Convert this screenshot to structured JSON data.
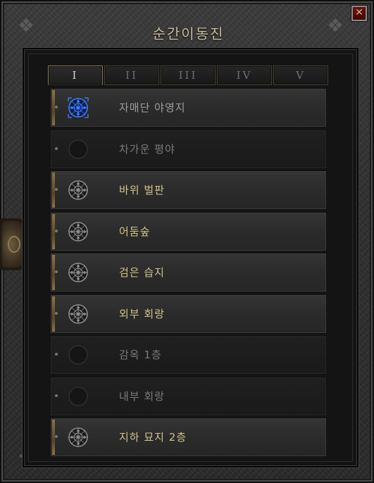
{
  "window": {
    "title": "순간이동진",
    "close_glyph": "✕"
  },
  "tabs": [
    {
      "label": "I",
      "active": true
    },
    {
      "label": "II",
      "active": false
    },
    {
      "label": "III",
      "active": false
    },
    {
      "label": "IV",
      "active": false
    },
    {
      "label": "V",
      "active": false
    }
  ],
  "waypoints": [
    {
      "label": "자매단 야영지",
      "state": "current",
      "icon": "waypoint-active-icon"
    },
    {
      "label": "차가운 평야",
      "state": "locked",
      "icon": "waypoint-empty-icon"
    },
    {
      "label": "바위 벌판",
      "state": "unlocked",
      "icon": "waypoint-icon"
    },
    {
      "label": "어둠숲",
      "state": "unlocked",
      "icon": "waypoint-icon"
    },
    {
      "label": "검은 습지",
      "state": "unlocked",
      "icon": "waypoint-icon"
    },
    {
      "label": "외부 회랑",
      "state": "unlocked",
      "icon": "waypoint-icon"
    },
    {
      "label": "감옥 1층",
      "state": "locked",
      "icon": "waypoint-empty-icon"
    },
    {
      "label": "내부 회랑",
      "state": "locked",
      "icon": "waypoint-empty-icon"
    },
    {
      "label": "지하 묘지 2층",
      "state": "unlocked",
      "icon": "waypoint-icon"
    }
  ],
  "colors": {
    "unlocked_text": "#d2c48a",
    "locked_text": "#7a7a7a",
    "current_icon": "#3b7bff",
    "gold_accent": "#8f7440"
  }
}
